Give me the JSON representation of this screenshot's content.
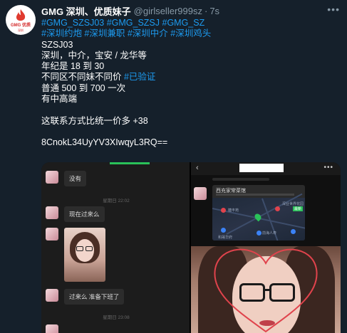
{
  "tweet": {
    "avatar": {
      "text": "GMG 优质",
      "sub": "深圳"
    },
    "display_name": "GMG 深圳、优质妹子",
    "handle": "@girlseller999sz",
    "separator": "·",
    "time": "7s",
    "more_icon": "more-icon",
    "lines": [
      {
        "parts": [
          {
            "text": "#GMG_SZSJ03 #GMG_SZSJ #GMG_SZ",
            "tag": true
          }
        ]
      },
      {
        "parts": [
          {
            "text": "#深圳约炮 #深圳兼职 #深圳中介 #深圳鸡头",
            "tag": true
          }
        ]
      },
      {
        "parts": [
          {
            "text": "SZSJ03",
            "tag": false
          }
        ]
      },
      {
        "parts": [
          {
            "text": "深圳，中介，宝安 / 龙华等",
            "tag": false
          }
        ]
      },
      {
        "parts": [
          {
            "text": "年纪是 18 到 30",
            "tag": false
          }
        ]
      },
      {
        "parts": [
          {
            "text": "不同区不同妹不同价 ",
            "tag": false
          },
          {
            "text": "#已验证",
            "tag": true
          }
        ]
      },
      {
        "parts": [
          {
            "text": "普通 500 到 700 一次",
            "tag": false
          }
        ]
      },
      {
        "parts": [
          {
            "text": "有中高端",
            "tag": false
          }
        ]
      },
      {
        "parts": [
          {
            "text": "",
            "tag": false
          }
        ]
      },
      {
        "parts": [
          {
            "text": "这联系方式比统一价多 +38",
            "tag": false
          }
        ]
      },
      {
        "parts": [
          {
            "text": "",
            "tag": false
          }
        ]
      },
      {
        "parts": [
          {
            "text": "8CnokL34UyYV3XIwqyL3RQ==",
            "tag": false
          }
        ]
      }
    ]
  },
  "media": {
    "chat": {
      "messages": [
        "没有",
        "现在过来么",
        "过来么 准备下班了"
      ],
      "timestamps": [
        "星期日 22:02",
        "星期日 23:08"
      ]
    },
    "map": {
      "title": "西充家常菜馆",
      "labels": [
        "糖丰苑",
        "前海人寿",
        "和晟华府",
        "深业世界花园"
      ],
      "tag": "最新"
    }
  },
  "colors": {
    "background": "#15202b",
    "link": "#1d9bf0",
    "muted": "#8899a6",
    "heart": "#e0434c"
  }
}
